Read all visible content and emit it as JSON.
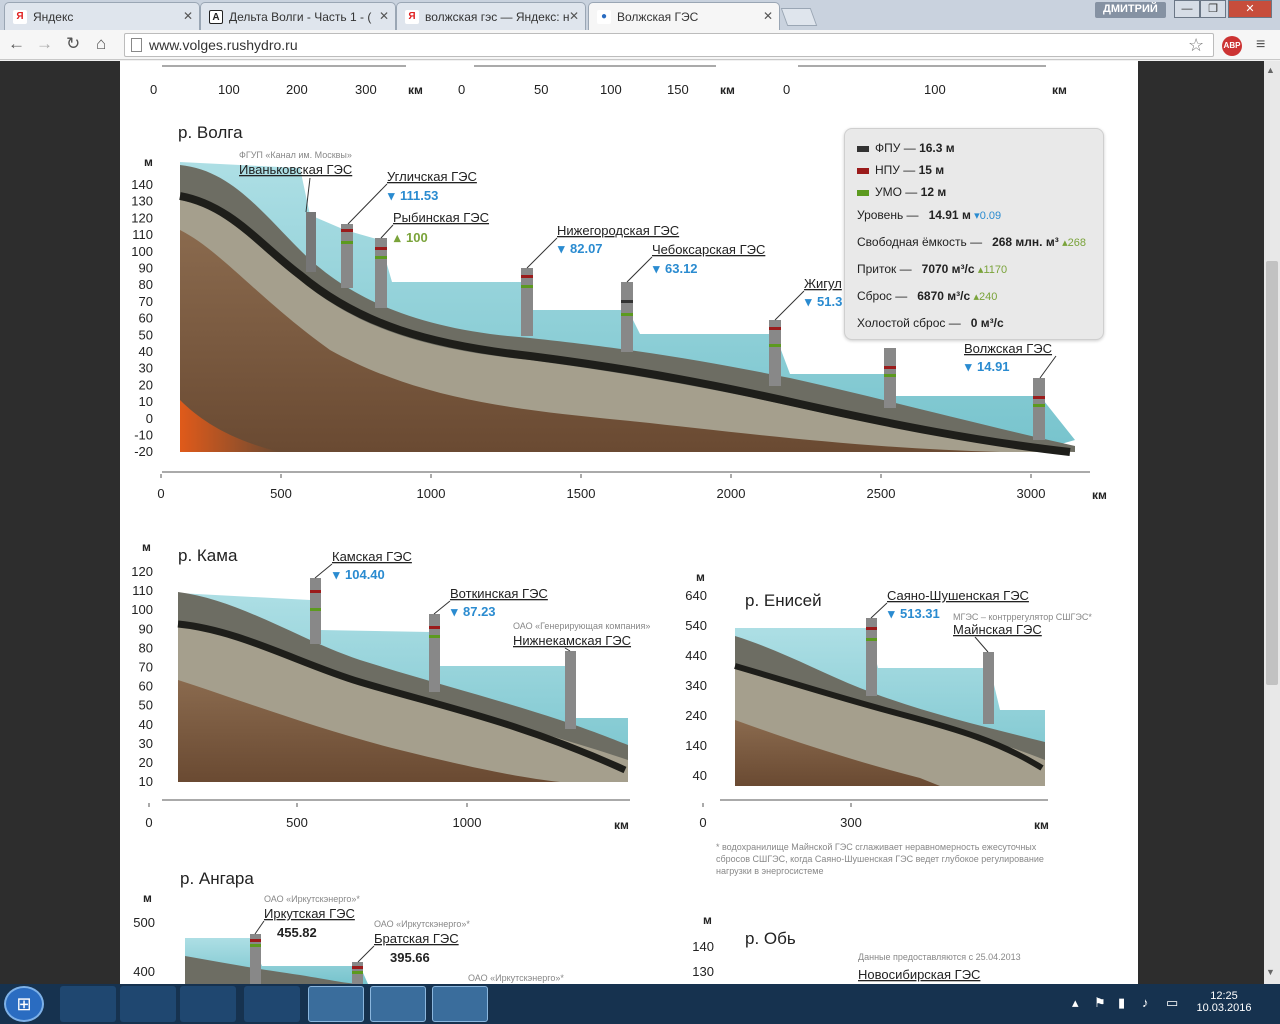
{
  "browser": {
    "tabs": [
      {
        "label": "Яндекс",
        "fav": "Я",
        "favcolor": "#e02020"
      },
      {
        "label": "Дельта Волги - Часть 1 - (",
        "fav": "A",
        "favcolor": "#222"
      },
      {
        "label": "волжская гэс — Яндекс: н",
        "fav": "Я",
        "favcolor": "#e02020"
      },
      {
        "label": "Волжская ГЭС",
        "fav": "●",
        "favcolor": "#2a6cc1"
      }
    ],
    "user": "ДМИТРИЙ",
    "url": "www.volges.rushydro.ru",
    "abp": "ABP"
  },
  "top_scales": [
    {
      "ticks": [
        "0",
        "100",
        "200",
        "300"
      ],
      "unit": "км"
    },
    {
      "ticks": [
        "0",
        "50",
        "100",
        "150"
      ],
      "unit": "км"
    },
    {
      "ticks": [
        "0",
        "100"
      ],
      "unit": "км"
    }
  ],
  "volga": {
    "river": "р. Волга",
    "unit_y": "м",
    "unit_x": "км",
    "yticks": [
      "140",
      "130",
      "120",
      "110",
      "100",
      "90",
      "80",
      "70",
      "60",
      "50",
      "40",
      "30",
      "20",
      "10",
      "0",
      "-10",
      "-20"
    ],
    "xticks": [
      "0",
      "500",
      "1000",
      "1500",
      "2000",
      "2500",
      "3000"
    ],
    "stations": [
      {
        "name": "Иваньковская ГЭС",
        "owner": "ФГУП «Канал им. Москвы»",
        "level": ""
      },
      {
        "name": "Угличская ГЭС",
        "owner": "",
        "level": "111.53"
      },
      {
        "name": "Рыбинская ГЭС",
        "owner": "",
        "level": "100"
      },
      {
        "name": "Нижегородская ГЭС",
        "owner": "",
        "level": "82.07"
      },
      {
        "name": "Чебоксарская ГЭС",
        "owner": "",
        "level": "63.12"
      },
      {
        "name": "Жигул",
        "owner": "",
        "level": "51.3"
      },
      {
        "name": "Волжская ГЭС",
        "owner": "",
        "level": "14.91"
      }
    ]
  },
  "legend": {
    "fpu": {
      "label": "ФПУ —",
      "value": "16.3 м",
      "color": "#333333"
    },
    "npu": {
      "label": "НПУ —",
      "value": "15 м",
      "color": "#9b1b1b"
    },
    "umo": {
      "label": "УМО —",
      "value": "12 м",
      "color": "#5c9a1f"
    },
    "level": {
      "label": "Уровень —",
      "value": "14.91 м",
      "delta": "0.09"
    },
    "capacity": {
      "label": "Свободная ёмкость —",
      "value": "268 млн. м³",
      "delta": "268"
    },
    "inflow": {
      "label": "Приток —",
      "value": "7070 м³/с",
      "delta": "1170"
    },
    "discharge": {
      "label": "Сброс —",
      "value": "6870 м³/с",
      "delta": "240"
    },
    "idle": {
      "label": "Холостой сброс —",
      "value": "0 м³/с"
    }
  },
  "kama": {
    "river": "р. Кама",
    "unit_y": "м",
    "unit_x": "км",
    "yticks": [
      "120",
      "110",
      "100",
      "90",
      "80",
      "70",
      "60",
      "50",
      "40",
      "30",
      "20",
      "10"
    ],
    "xticks": [
      "0",
      "500",
      "1000"
    ],
    "stations": [
      {
        "name": "Камская ГЭС",
        "owner": "",
        "level": "104.40"
      },
      {
        "name": "Воткинская ГЭС",
        "owner": "",
        "level": "87.23"
      },
      {
        "name": "Нижнекамская ГЭС",
        "owner": "ОАО «Генерирующая компания»",
        "level": ""
      }
    ]
  },
  "enisei": {
    "river": "р. Енисей",
    "unit_y": "м",
    "unit_x": "км",
    "yticks": [
      "640",
      "540",
      "440",
      "340",
      "240",
      "140",
      "40"
    ],
    "xticks": [
      "0",
      "300"
    ],
    "stations": [
      {
        "name": "Саяно-Шушенская ГЭС",
        "owner": "",
        "level": "513.31"
      },
      {
        "name": "Майнская ГЭС",
        "owner": "МГЭС – контррегулятор СШГЭС*",
        "level": ""
      }
    ],
    "note": [
      "* водохранилище Майнской ГЭС сглаживает неравномерность ежесуточных",
      "сбросов СШГЭС, когда Саяно-Шушенская ГЭС ведет глубокое регулирование",
      "нагрузки в энергосистеме"
    ]
  },
  "angara": {
    "river": "р. Ангара",
    "unit_y": "м",
    "yticks": [
      "500",
      "400"
    ],
    "stations": [
      {
        "name": "Иркутская ГЭС",
        "owner": "ОАО «Иркутскэнерго»*",
        "level": "455.82"
      },
      {
        "name": "Братская ГЭС",
        "owner": "ОАО «Иркутскэнерго»*",
        "level": "395.66"
      },
      {
        "name": "",
        "owner": "ОАО «Иркутскэнерго»*",
        "level": ""
      }
    ]
  },
  "ob": {
    "river": "р. Обь",
    "unit_y": "м",
    "yticks": [
      "140",
      "130"
    ],
    "date_note": "Данные предоставляются с 25.04.2013",
    "stations": [
      {
        "name": "Новосибирская ГЭС"
      }
    ]
  },
  "taskbar": {
    "time": "12:25",
    "date": "10.03.2016"
  }
}
